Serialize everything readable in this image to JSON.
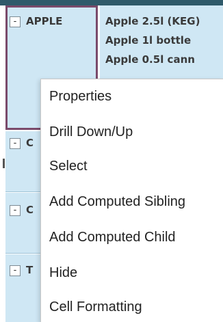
{
  "pivot": {
    "rows": [
      {
        "expander": "-",
        "label": "APPLE"
      },
      {
        "expander": "-",
        "label": "C"
      },
      {
        "expander": "-",
        "label": "C"
      },
      {
        "expander": "-",
        "label": "T"
      }
    ],
    "apple_items": [
      "Apple 2.5l (KEG)",
      "Apple 1l bottle",
      "Apple 0.5l cann"
    ]
  },
  "context_menu": {
    "items": [
      "Properties",
      "Drill Down/Up",
      "Select",
      "Add Computed Sibling",
      "Add Computed Child",
      "Hide",
      "Cell Formatting"
    ]
  },
  "colors": {
    "cell_bg": "#cfe7f4",
    "selection_border": "#7a4a6a",
    "header_strip": "#2f5a6a"
  }
}
